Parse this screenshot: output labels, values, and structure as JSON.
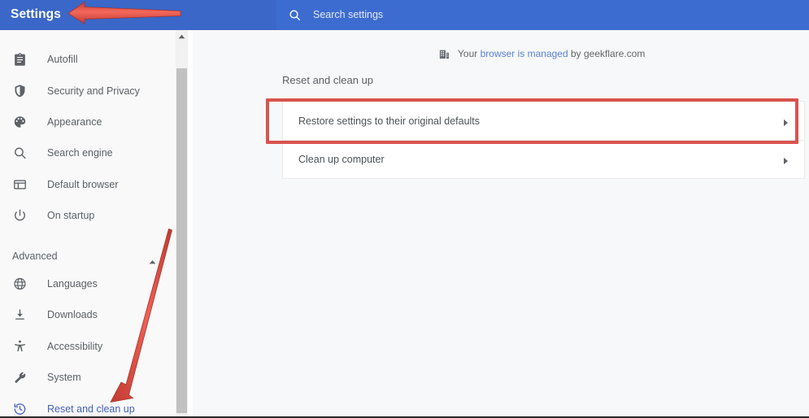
{
  "header": {
    "title": "Settings",
    "search_icon": "search-icon",
    "search_placeholder": "Search settings",
    "search_value": ""
  },
  "sidebar": {
    "items": [
      {
        "label": "Autofill",
        "icon": "clipboard-icon",
        "active": false
      },
      {
        "label": "Security and Privacy",
        "icon": "shield-icon",
        "active": false
      },
      {
        "label": "Appearance",
        "icon": "palette-icon",
        "active": false
      },
      {
        "label": "Search engine",
        "icon": "magnifier-icon",
        "active": false
      },
      {
        "label": "Default browser",
        "icon": "browser-window-icon",
        "active": false
      },
      {
        "label": "On startup",
        "icon": "power-icon",
        "active": false
      }
    ],
    "advanced_section": {
      "label": "Advanced",
      "chevron_icon": "chevron-up-icon",
      "expanded": true,
      "items": [
        {
          "label": "Languages",
          "icon": "globe-icon",
          "active": false
        },
        {
          "label": "Downloads",
          "icon": "download-icon",
          "active": false
        },
        {
          "label": "Accessibility",
          "icon": "accessibility-person-icon",
          "active": false
        },
        {
          "label": "System",
          "icon": "wrench-icon",
          "active": false
        },
        {
          "label": "Reset and clean up",
          "icon": "history-restore-icon",
          "active": true
        }
      ]
    }
  },
  "managed_notice": {
    "icon": "enterprise-building-icon",
    "prefix": "Your ",
    "link": "browser is managed",
    "suffix": " by geekflare.com"
  },
  "main": {
    "section_title": "Reset and clean up",
    "rows": [
      {
        "label": "Restore settings to their original defaults",
        "chevron": "chevron-right-icon",
        "highlighted": true
      },
      {
        "label": "Clean up computer",
        "chevron": "chevron-right-icon",
        "highlighted": false
      }
    ]
  },
  "annotations": {
    "highlight_color": "#d9534f",
    "arrow_color": "#e2493f",
    "items": [
      {
        "name": "arrow-to-settings-title",
        "direction": "left"
      },
      {
        "name": "arrow-to-reset-and-clean-up",
        "direction": "down-left"
      },
      {
        "name": "highlight-box-restore-settings",
        "shape": "rectangle"
      }
    ]
  },
  "colors": {
    "topbar_blue": "#3a67c8",
    "search_blue": "#3d6cd0",
    "link_blue": "#5a7fd4",
    "active_nav_blue": "#4460b8",
    "content_bg": "#f7f8f9",
    "sidebar_bg": "#f9f9fa"
  }
}
